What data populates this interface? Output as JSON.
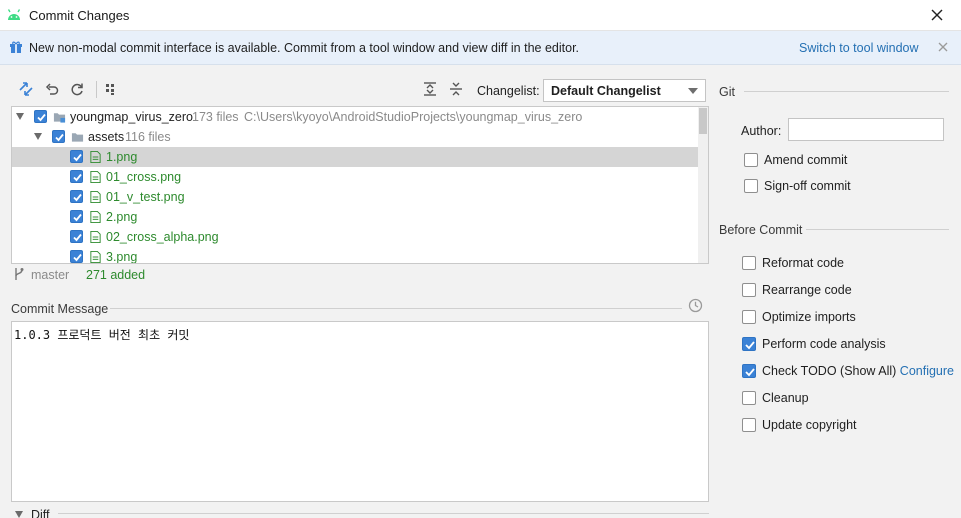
{
  "window": {
    "title": "Commit Changes"
  },
  "banner": {
    "message": "New non-modal commit interface is available. Commit from a tool window and view diff in the editor.",
    "link": "Switch to tool window"
  },
  "toolbar": {
    "icons": [
      "show-diff-icon",
      "rollback-icon",
      "refresh-icon",
      "group-by-icon",
      "expand-all-icon",
      "collapse-all-icon"
    ],
    "changelist_label": "Changelist:",
    "changelist_value": "Default Changelist"
  },
  "tree": {
    "root": {
      "name": "youngmap_virus_zero",
      "count": "173 files",
      "path": "C:\\Users\\kyoyo\\AndroidStudioProjects\\youngmap_virus_zero"
    },
    "folder": {
      "name": "assets",
      "count": "116 files"
    },
    "files": [
      "1.png",
      "01_cross.png",
      "01_v_test.png",
      "2.png",
      "02_cross_alpha.png",
      "3.png"
    ]
  },
  "status": {
    "branch": "master",
    "added": "271 added"
  },
  "commit_message": {
    "label": "Commit Message",
    "text": "1.0.3 프로덕트 버전 최초 커밋"
  },
  "diff": {
    "label": "Diff"
  },
  "git": {
    "title": "Git",
    "author_label": "Author:",
    "author_value": "",
    "options": [
      {
        "label": "Amend commit",
        "checked": false
      },
      {
        "label": "Sign-off commit",
        "checked": false
      }
    ]
  },
  "before_commit": {
    "title": "Before Commit",
    "configure_link": "Configure",
    "options": [
      {
        "label": "Reformat code",
        "checked": false
      },
      {
        "label": "Rearrange code",
        "checked": false
      },
      {
        "label": "Optimize imports",
        "checked": false
      },
      {
        "label": "Perform code analysis",
        "checked": true
      },
      {
        "label": "Check TODO (Show All)",
        "checked": true
      },
      {
        "label": "Cleanup",
        "checked": false
      },
      {
        "label": "Update copyright",
        "checked": false
      }
    ]
  },
  "colors": {
    "accent": "#3b82d6",
    "link": "#2470b3",
    "added": "#2d8a2d",
    "banner_bg": "#e8f0fa"
  }
}
